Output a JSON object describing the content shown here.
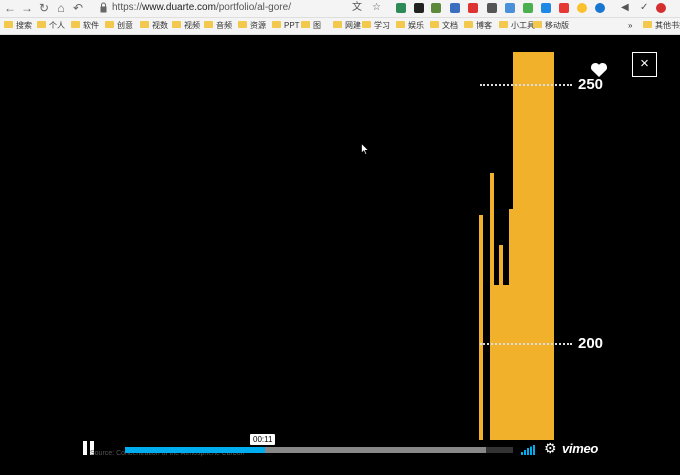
{
  "browser": {
    "url_scheme": "https://",
    "url_host": "www.duarte.com",
    "url_path": "/portfolio/al-gore/"
  },
  "bookmarks": [
    {
      "label": "搜索"
    },
    {
      "label": "个人"
    },
    {
      "label": "软件"
    },
    {
      "label": "创意"
    },
    {
      "label": "视数"
    },
    {
      "label": "视频"
    },
    {
      "label": "音频"
    },
    {
      "label": "资源"
    },
    {
      "label": "PPT"
    },
    {
      "label": "图"
    },
    {
      "label": "网建"
    },
    {
      "label": "学习"
    },
    {
      "label": "娱乐"
    },
    {
      "label": "文档"
    },
    {
      "label": "博客"
    },
    {
      "label": "小工具"
    },
    {
      "label": "移动版"
    }
  ],
  "bookmarks_overflow": "»",
  "other_bookmarks": "其他书签",
  "chart_data": {
    "type": "bar",
    "tick_labels": [
      "250",
      "200"
    ],
    "bar_color": "#f2b12a"
  },
  "player": {
    "time": "00:11",
    "played_fraction": 0.36,
    "loaded_fraction": 0.93,
    "caption": "Source: Concentration of the Atmospheric Carbon",
    "brand": "vimeo",
    "close_label": "×"
  }
}
